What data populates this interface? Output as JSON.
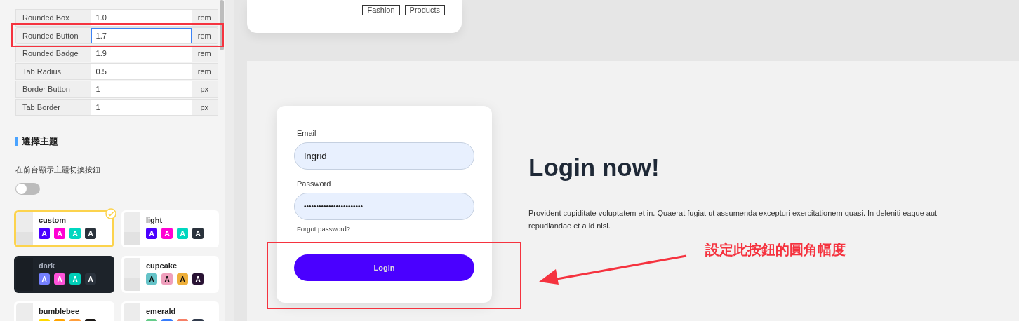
{
  "settings": [
    {
      "label": "Rounded Box",
      "value": "1.0",
      "unit": "rem",
      "focused": false
    },
    {
      "label": "Rounded Button",
      "value": "1.7",
      "unit": "rem",
      "focused": true
    },
    {
      "label": "Rounded Badge",
      "value": "1.9",
      "unit": "rem",
      "focused": false
    },
    {
      "label": "Tab Radius",
      "value": "0.5",
      "unit": "rem",
      "focused": false
    },
    {
      "label": "Border Button",
      "value": "1",
      "unit": "px",
      "focused": false
    },
    {
      "label": "Tab Border",
      "value": "1",
      "unit": "px",
      "focused": false
    }
  ],
  "theme_section": {
    "heading": "選擇主題",
    "toggle_label": "在前台顯示主題切換按鈕",
    "toggle_on": false
  },
  "themes": [
    {
      "name": "custom",
      "selected": true,
      "dark": false,
      "swatches": [
        {
          "label": "A",
          "color": "#4a00ff"
        },
        {
          "label": "A",
          "color": "#ff00d3"
        },
        {
          "label": "A",
          "color": "#00d7c0"
        },
        {
          "label": "A",
          "color": "#2a323c"
        }
      ]
    },
    {
      "name": "light",
      "selected": false,
      "dark": false,
      "swatches": [
        {
          "label": "A",
          "color": "#4a00ff"
        },
        {
          "label": "A",
          "color": "#ff00d3"
        },
        {
          "label": "A",
          "color": "#00d7c0"
        },
        {
          "label": "A",
          "color": "#2a323c"
        }
      ]
    },
    {
      "name": "dark",
      "selected": false,
      "dark": true,
      "swatches": [
        {
          "label": "A",
          "color": "#7480ff"
        },
        {
          "label": "A",
          "color": "#ff52d9"
        },
        {
          "label": "A",
          "color": "#00cdb7"
        },
        {
          "label": "A",
          "color": "#2a323c"
        }
      ]
    },
    {
      "name": "cupcake",
      "selected": false,
      "dark": false,
      "swatches": [
        {
          "label": "A",
          "color": "#65c3c8"
        },
        {
          "label": "A",
          "color": "#ef9fbc"
        },
        {
          "label": "A",
          "color": "#eeaf3a"
        },
        {
          "label": "A",
          "color": "#291334"
        }
      ]
    },
    {
      "name": "bumblebee",
      "selected": false,
      "dark": false,
      "swatches": [
        {
          "color": "#ffd900"
        },
        {
          "color": "#ffa400"
        },
        {
          "color": "#ff9e3c"
        },
        {
          "color": "#1c1917"
        }
      ]
    },
    {
      "name": "emerald",
      "selected": false,
      "dark": false,
      "swatches": [
        {
          "color": "#66cc8a"
        },
        {
          "color": "#377cfb"
        },
        {
          "color": "#f68067"
        },
        {
          "color": "#333c4d"
        }
      ]
    }
  ],
  "preview_card": {
    "tags": [
      "Fashion",
      "Products"
    ]
  },
  "login": {
    "email_label": "Email",
    "email_value": "Ingrid",
    "password_label": "Password",
    "password_value": "••••••••••••••••••••••••",
    "forgot": "Forgot password?",
    "button": "Login",
    "heading": "Login now!",
    "text": "Provident cupiditate voluptatem et in. Quaerat fugiat ut assumenda excepturi exercitationem quasi. In deleniti eaque aut repudiandae et a id nisi."
  },
  "annotation": {
    "callout": "設定此按鈕的圓角幅度"
  }
}
